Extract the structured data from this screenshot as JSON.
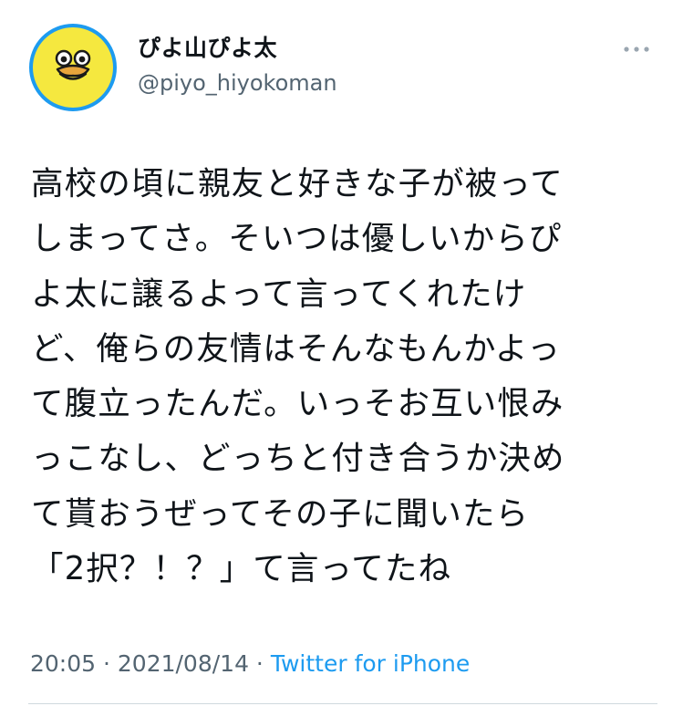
{
  "user": {
    "display_name": "ぴよ山ぴよ太",
    "handle": "@piyo_hiyokoman",
    "avatar": "yellow-bird-avatar"
  },
  "tweet": {
    "text": "高校の頃に親友と好きな子が被って\nしまってさ。そいつは優しいからぴ\nよ太に譲るよって言ってくれたけ\nど、俺らの友情はそんなもんかよっ\nて腹立ったんだ。いっそお互い恨み\nっこなし、どっちと付き合うか決め\nて貰おうぜってその子に聞いたら\n「2択？！？」て言ってたね"
  },
  "meta": {
    "time": "20:05",
    "separator1": " · ",
    "date": "2021/08/14",
    "separator2": " · ",
    "source": "Twitter for iPhone"
  },
  "icons": {
    "more": "more-horizontal-icon"
  },
  "colors": {
    "avatar_ring": "#1d9bf0",
    "avatar_fill": "#f5e83f",
    "text": "#0f1419",
    "secondary": "#536471",
    "link": "#1d9bf0",
    "divider": "#cfd9de"
  }
}
